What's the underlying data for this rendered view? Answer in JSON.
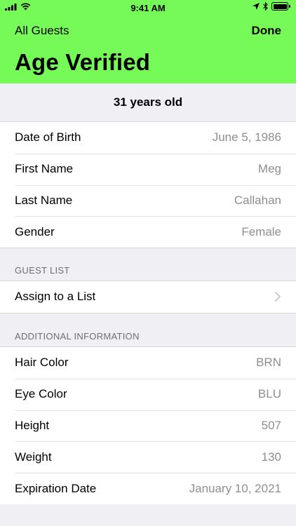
{
  "status": {
    "time": "9:41 AM"
  },
  "nav": {
    "back_label": "All Guests",
    "done_label": "Done",
    "title": "Age Verified"
  },
  "age_banner": "31 years old",
  "identity": [
    {
      "label": "Date of Birth",
      "value": "June 5, 1986"
    },
    {
      "label": "First Name",
      "value": "Meg"
    },
    {
      "label": "Last Name",
      "value": "Callahan"
    },
    {
      "label": "Gender",
      "value": "Female"
    }
  ],
  "guest_list": {
    "header": "GUEST LIST",
    "row_label": "Assign to a List"
  },
  "additional": {
    "header": "ADDITIONAL INFORMATION",
    "rows": [
      {
        "label": "Hair Color",
        "value": "BRN"
      },
      {
        "label": "Eye Color",
        "value": "BLU"
      },
      {
        "label": "Height",
        "value": "507"
      },
      {
        "label": "Weight",
        "value": "130"
      },
      {
        "label": "Expiration Date",
        "value": "January 10, 2021"
      }
    ]
  },
  "colors": {
    "header_bg": "#76fa58",
    "secondary_text": "#8e8e93",
    "background": "#efeff4"
  }
}
